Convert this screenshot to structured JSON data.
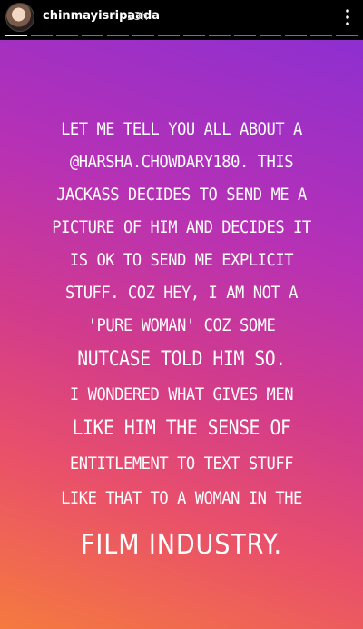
{
  "header": {
    "username": "chinmayisripaada",
    "timestamp": "23h",
    "avatar_icon": "profile-avatar",
    "more_icon": "more-options-icon"
  },
  "progress": {
    "segments": 14,
    "active_index": 0
  },
  "story": {
    "background_colors": [
      "#8e2fd0",
      "#b631b5",
      "#d23b8c",
      "#e9506a",
      "#f57a3f"
    ],
    "lines": [
      "LET ME TELL YOU ALL ABOUT A",
      "@HARSHA.CHOWDARY180. THIS",
      "JACKASS DECIDES TO SEND ME A",
      "PICTURE OF HIM AND DECIDES IT",
      "IS OK TO SEND ME EXPLICIT",
      "STUFF. COZ HEY, I AM NOT A",
      "'PURE WOMAN' COZ SOME",
      "NUTCASE TOLD HIM SO.",
      "I WONDERED WHAT GIVES MEN",
      "LIKE HIM THE SENSE OF",
      "ENTITLEMENT TO TEXT STUFF",
      "LIKE THAT TO A WOMAN IN THE",
      "FILM INDUSTRY."
    ]
  }
}
